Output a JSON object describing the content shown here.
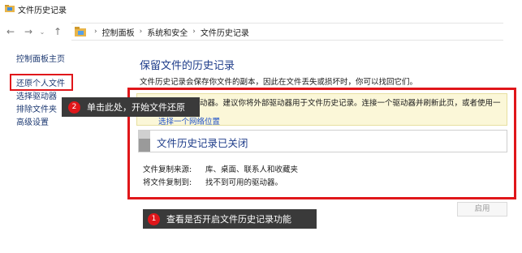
{
  "window": {
    "title": "文件历史记录"
  },
  "address": {
    "breadcrumbs": [
      "控制面板",
      "系统和安全",
      "文件历史记录"
    ]
  },
  "leftnav": {
    "home": "控制面板主页",
    "items": [
      "还原个人文件",
      "选择驱动器",
      "排除文件夹",
      "高级设置"
    ]
  },
  "main": {
    "title": "保留文件的历史记录",
    "description": "文件历史记录会保存你文件的副本，因此在文件丢失或损坏时，你可以找回它们。",
    "warning": {
      "text": "找不到可用驱动器。建议你将外部驱动器用于文件历史记录。连接一个驱动器并刷新此页，或者使用一",
      "link": "选择一个网络位置"
    },
    "status_title": "文件历史记录已关闭",
    "info": [
      {
        "label": "文件复制来源:",
        "value": "库、桌面、联系人和收藏夹"
      },
      {
        "label": "将文件复制到:",
        "value": "找不到可用的驱动器。"
      }
    ],
    "enable_button": "启用"
  },
  "callouts": [
    {
      "badge": "2",
      "text": "单击此处，开始文件还原"
    },
    {
      "badge": "1",
      "text": "查看是否开启文件历史记录功能"
    }
  ],
  "colors": {
    "accent_red": "#e0161a",
    "title_blue": "#1e3c8a",
    "link_blue": "#1f52c9",
    "warning_bg": "#fbf7d8"
  }
}
